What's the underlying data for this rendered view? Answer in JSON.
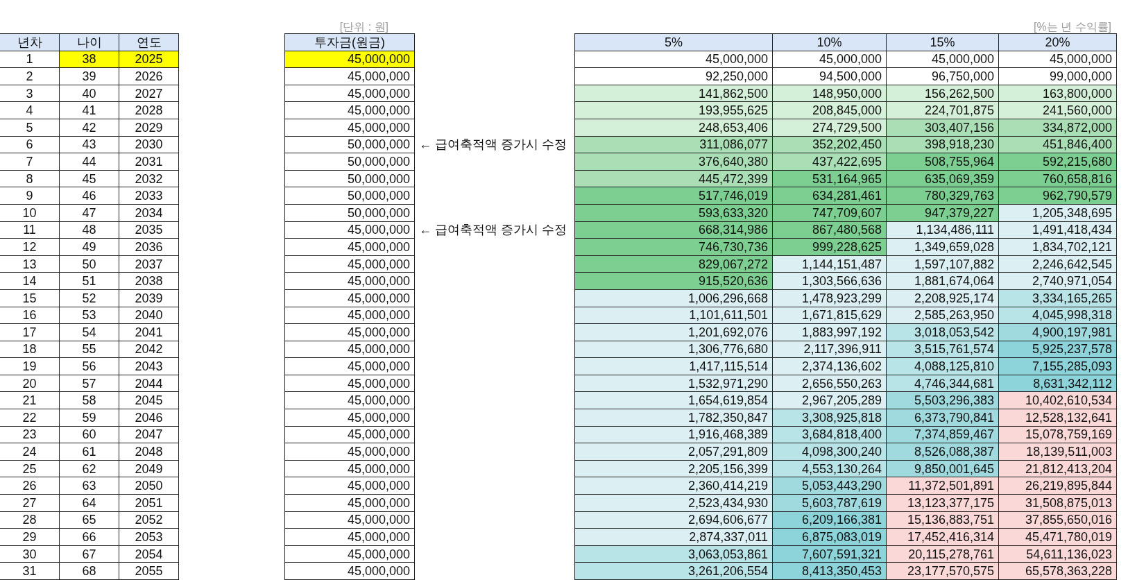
{
  "unit_label": "[단위 : 원]",
  "rate_label": "[%는 년 수익률]",
  "schedule": {
    "columns": [
      "년차",
      "나이",
      "연도"
    ],
    "rows": [
      {
        "year_no": "1",
        "age": "38",
        "year": "2025",
        "highlighted": true
      },
      {
        "year_no": "2",
        "age": "39",
        "year": "2026",
        "highlighted": false
      },
      {
        "year_no": "3",
        "age": "40",
        "year": "2027",
        "highlighted": false
      },
      {
        "year_no": "4",
        "age": "41",
        "year": "2028",
        "highlighted": false
      },
      {
        "year_no": "5",
        "age": "42",
        "year": "2029",
        "highlighted": false
      },
      {
        "year_no": "6",
        "age": "43",
        "year": "2030",
        "highlighted": false
      },
      {
        "year_no": "7",
        "age": "44",
        "year": "2031",
        "highlighted": false
      },
      {
        "year_no": "8",
        "age": "45",
        "year": "2032",
        "highlighted": false
      },
      {
        "year_no": "9",
        "age": "46",
        "year": "2033",
        "highlighted": false
      },
      {
        "year_no": "10",
        "age": "47",
        "year": "2034",
        "highlighted": false
      },
      {
        "year_no": "11",
        "age": "48",
        "year": "2035",
        "highlighted": false
      },
      {
        "year_no": "12",
        "age": "49",
        "year": "2036",
        "highlighted": false
      },
      {
        "year_no": "13",
        "age": "50",
        "year": "2037",
        "highlighted": false
      },
      {
        "year_no": "14",
        "age": "51",
        "year": "2038",
        "highlighted": false
      },
      {
        "year_no": "15",
        "age": "52",
        "year": "2039",
        "highlighted": false
      },
      {
        "year_no": "16",
        "age": "53",
        "year": "2040",
        "highlighted": false
      },
      {
        "year_no": "17",
        "age": "54",
        "year": "2041",
        "highlighted": false
      },
      {
        "year_no": "18",
        "age": "55",
        "year": "2042",
        "highlighted": false
      },
      {
        "year_no": "19",
        "age": "56",
        "year": "2043",
        "highlighted": false
      },
      {
        "year_no": "20",
        "age": "57",
        "year": "2044",
        "highlighted": false
      },
      {
        "year_no": "21",
        "age": "58",
        "year": "2045",
        "highlighted": false
      },
      {
        "year_no": "22",
        "age": "59",
        "year": "2046",
        "highlighted": false
      },
      {
        "year_no": "23",
        "age": "60",
        "year": "2047",
        "highlighted": false
      },
      {
        "year_no": "24",
        "age": "61",
        "year": "2048",
        "highlighted": false
      },
      {
        "year_no": "25",
        "age": "62",
        "year": "2049",
        "highlighted": false
      },
      {
        "year_no": "26",
        "age": "63",
        "year": "2050",
        "highlighted": false
      },
      {
        "year_no": "27",
        "age": "64",
        "year": "2051",
        "highlighted": false
      },
      {
        "year_no": "28",
        "age": "65",
        "year": "2052",
        "highlighted": false
      },
      {
        "year_no": "29",
        "age": "66",
        "year": "2053",
        "highlighted": false
      },
      {
        "year_no": "30",
        "age": "67",
        "year": "2054",
        "highlighted": false
      },
      {
        "year_no": "31",
        "age": "68",
        "year": "2055",
        "highlighted": false
      }
    ]
  },
  "investment": {
    "column": "투자금(원금)",
    "rows": [
      {
        "amount": "45,000,000",
        "highlighted": true
      },
      {
        "amount": "45,000,000",
        "highlighted": false
      },
      {
        "amount": "45,000,000",
        "highlighted": false
      },
      {
        "amount": "45,000,000",
        "highlighted": false
      },
      {
        "amount": "45,000,000",
        "highlighted": false
      },
      {
        "amount": "50,000,000",
        "highlighted": false,
        "note": "← 급여축적액 증가시 수정"
      },
      {
        "amount": "50,000,000",
        "highlighted": false
      },
      {
        "amount": "50,000,000",
        "highlighted": false
      },
      {
        "amount": "50,000,000",
        "highlighted": false
      },
      {
        "amount": "50,000,000",
        "highlighted": false
      },
      {
        "amount": "45,000,000",
        "highlighted": false,
        "note": "← 급여축적액 증가시 수정"
      },
      {
        "amount": "45,000,000",
        "highlighted": false
      },
      {
        "amount": "45,000,000",
        "highlighted": false
      },
      {
        "amount": "45,000,000",
        "highlighted": false
      },
      {
        "amount": "45,000,000",
        "highlighted": false
      },
      {
        "amount": "45,000,000",
        "highlighted": false
      },
      {
        "amount": "45,000,000",
        "highlighted": false
      },
      {
        "amount": "45,000,000",
        "highlighted": false
      },
      {
        "amount": "45,000,000",
        "highlighted": false
      },
      {
        "amount": "45,000,000",
        "highlighted": false
      },
      {
        "amount": "45,000,000",
        "highlighted": false
      },
      {
        "amount": "45,000,000",
        "highlighted": false
      },
      {
        "amount": "45,000,000",
        "highlighted": false
      },
      {
        "amount": "45,000,000",
        "highlighted": false
      },
      {
        "amount": "45,000,000",
        "highlighted": false
      },
      {
        "amount": "45,000,000",
        "highlighted": false
      },
      {
        "amount": "45,000,000",
        "highlighted": false
      },
      {
        "amount": "45,000,000",
        "highlighted": false
      },
      {
        "amount": "45,000,000",
        "highlighted": false
      },
      {
        "amount": "45,000,000",
        "highlighted": false
      },
      {
        "amount": "45,000,000",
        "highlighted": false
      }
    ]
  },
  "returns": {
    "columns": [
      "5%",
      "10%",
      "15%",
      "20%"
    ],
    "rows": [
      {
        "cells": [
          {
            "value": "45,000,000",
            "color": "#ffffff"
          },
          {
            "value": "45,000,000",
            "color": "#ffffff"
          },
          {
            "value": "45,000,000",
            "color": "#ffffff"
          },
          {
            "value": "45,000,000",
            "color": "#ffffff"
          }
        ]
      },
      {
        "cells": [
          {
            "value": "92,250,000",
            "color": "#ffffff"
          },
          {
            "value": "94,500,000",
            "color": "#ffffff"
          },
          {
            "value": "96,750,000",
            "color": "#ffffff"
          },
          {
            "value": "99,000,000",
            "color": "#ffffff"
          }
        ]
      },
      {
        "cells": [
          {
            "value": "141,862,500",
            "color": "#d5f0d8"
          },
          {
            "value": "148,950,000",
            "color": "#d5f0d8"
          },
          {
            "value": "156,262,500",
            "color": "#d5f0d8"
          },
          {
            "value": "163,800,000",
            "color": "#d5f0d8"
          }
        ]
      },
      {
        "cells": [
          {
            "value": "193,955,625",
            "color": "#d5f0d8"
          },
          {
            "value": "208,845,000",
            "color": "#d5f0d8"
          },
          {
            "value": "224,701,875",
            "color": "#d5f0d8"
          },
          {
            "value": "241,560,000",
            "color": "#d5f0d8"
          }
        ]
      },
      {
        "cells": [
          {
            "value": "248,653,406",
            "color": "#d5f0d8"
          },
          {
            "value": "274,729,500",
            "color": "#d5f0d8"
          },
          {
            "value": "303,407,156",
            "color": "#aadfb6"
          },
          {
            "value": "334,872,000",
            "color": "#aadfb6"
          }
        ]
      },
      {
        "cells": [
          {
            "value": "311,086,077",
            "color": "#aadfb6"
          },
          {
            "value": "352,202,450",
            "color": "#aadfb6"
          },
          {
            "value": "398,918,230",
            "color": "#aadfb6"
          },
          {
            "value": "451,846,400",
            "color": "#aadfb6"
          }
        ]
      },
      {
        "cells": [
          {
            "value": "376,640,380",
            "color": "#aadfb6"
          },
          {
            "value": "437,422,695",
            "color": "#aadfb6"
          },
          {
            "value": "508,755,964",
            "color": "#7ccf90"
          },
          {
            "value": "592,215,680",
            "color": "#7ccf90"
          }
        ]
      },
      {
        "cells": [
          {
            "value": "445,472,399",
            "color": "#aadfb6"
          },
          {
            "value": "531,164,965",
            "color": "#7ccf90"
          },
          {
            "value": "635,069,359",
            "color": "#7ccf90"
          },
          {
            "value": "760,658,816",
            "color": "#7ccf90"
          }
        ]
      },
      {
        "cells": [
          {
            "value": "517,746,019",
            "color": "#7ccf90"
          },
          {
            "value": "634,281,461",
            "color": "#7ccf90"
          },
          {
            "value": "780,329,763",
            "color": "#7ccf90"
          },
          {
            "value": "962,790,579",
            "color": "#7ccf90"
          }
        ]
      },
      {
        "cells": [
          {
            "value": "593,633,320",
            "color": "#7ccf90"
          },
          {
            "value": "747,709,607",
            "color": "#7ccf90"
          },
          {
            "value": "947,379,227",
            "color": "#7ccf90"
          },
          {
            "value": "1,205,348,695",
            "color": "#dcf0f4"
          }
        ]
      },
      {
        "cells": [
          {
            "value": "668,314,986",
            "color": "#7ccf90"
          },
          {
            "value": "867,480,568",
            "color": "#7ccf90"
          },
          {
            "value": "1,134,486,111",
            "color": "#dcf0f4"
          },
          {
            "value": "1,491,418,434",
            "color": "#dcf0f4"
          }
        ]
      },
      {
        "cells": [
          {
            "value": "746,730,736",
            "color": "#7ccf90"
          },
          {
            "value": "999,228,625",
            "color": "#7ccf90"
          },
          {
            "value": "1,349,659,028",
            "color": "#dcf0f4"
          },
          {
            "value": "1,834,702,121",
            "color": "#dcf0f4"
          }
        ]
      },
      {
        "cells": [
          {
            "value": "829,067,272",
            "color": "#7ccf90"
          },
          {
            "value": "1,144,151,487",
            "color": "#dcf0f4"
          },
          {
            "value": "1,597,107,882",
            "color": "#dcf0f4"
          },
          {
            "value": "2,246,642,545",
            "color": "#dcf0f4"
          }
        ]
      },
      {
        "cells": [
          {
            "value": "915,520,636",
            "color": "#7ccf90"
          },
          {
            "value": "1,303,566,636",
            "color": "#dcf0f4"
          },
          {
            "value": "1,881,674,064",
            "color": "#dcf0f4"
          },
          {
            "value": "2,740,971,054",
            "color": "#dcf0f4"
          }
        ]
      },
      {
        "cells": [
          {
            "value": "1,006,296,668",
            "color": "#dcf0f4"
          },
          {
            "value": "1,478,923,299",
            "color": "#dcf0f4"
          },
          {
            "value": "2,208,925,174",
            "color": "#dcf0f4"
          },
          {
            "value": "3,334,165,265",
            "color": "#b8e3e7"
          }
        ]
      },
      {
        "cells": [
          {
            "value": "1,101,611,501",
            "color": "#dcf0f4"
          },
          {
            "value": "1,671,815,629",
            "color": "#dcf0f4"
          },
          {
            "value": "2,585,263,950",
            "color": "#dcf0f4"
          },
          {
            "value": "4,045,998,318",
            "color": "#b8e3e7"
          }
        ]
      },
      {
        "cells": [
          {
            "value": "1,201,692,076",
            "color": "#dcf0f4"
          },
          {
            "value": "1,883,997,192",
            "color": "#dcf0f4"
          },
          {
            "value": "3,018,053,542",
            "color": "#b8e3e7"
          },
          {
            "value": "4,900,197,981",
            "color": "#a0dadf"
          }
        ]
      },
      {
        "cells": [
          {
            "value": "1,306,776,680",
            "color": "#dcf0f4"
          },
          {
            "value": "2,117,396,911",
            "color": "#dcf0f4"
          },
          {
            "value": "3,515,761,574",
            "color": "#b8e3e7"
          },
          {
            "value": "5,925,237,578",
            "color": "#8dd3da"
          }
        ]
      },
      {
        "cells": [
          {
            "value": "1,417,115,514",
            "color": "#dcf0f4"
          },
          {
            "value": "2,374,136,602",
            "color": "#dcf0f4"
          },
          {
            "value": "4,088,125,810",
            "color": "#b8e3e7"
          },
          {
            "value": "7,155,285,093",
            "color": "#8dd3da"
          }
        ]
      },
      {
        "cells": [
          {
            "value": "1,532,971,290",
            "color": "#dcf0f4"
          },
          {
            "value": "2,656,550,263",
            "color": "#dcf0f4"
          },
          {
            "value": "4,746,344,681",
            "color": "#b8e3e7"
          },
          {
            "value": "8,631,342,112",
            "color": "#8dd3da"
          }
        ]
      },
      {
        "cells": [
          {
            "value": "1,654,619,854",
            "color": "#dcf0f4"
          },
          {
            "value": "2,967,205,289",
            "color": "#dcf0f4"
          },
          {
            "value": "5,503,296,383",
            "color": "#a0dadf"
          },
          {
            "value": "10,402,610,534",
            "color": "#fbd8d8"
          }
        ]
      },
      {
        "cells": [
          {
            "value": "1,782,350,847",
            "color": "#dcf0f4"
          },
          {
            "value": "3,308,925,818",
            "color": "#b8e3e7"
          },
          {
            "value": "6,373,790,841",
            "color": "#a0dadf"
          },
          {
            "value": "12,528,132,641",
            "color": "#fbd8d8"
          }
        ]
      },
      {
        "cells": [
          {
            "value": "1,916,468,389",
            "color": "#dcf0f4"
          },
          {
            "value": "3,684,818,400",
            "color": "#b8e3e7"
          },
          {
            "value": "7,374,859,467",
            "color": "#a0dadf"
          },
          {
            "value": "15,078,759,169",
            "color": "#fbd8d8"
          }
        ]
      },
      {
        "cells": [
          {
            "value": "2,057,291,809",
            "color": "#dcf0f4"
          },
          {
            "value": "4,098,300,240",
            "color": "#b8e3e7"
          },
          {
            "value": "8,526,088,387",
            "color": "#a0dadf"
          },
          {
            "value": "18,139,511,003",
            "color": "#fbd8d8"
          }
        ]
      },
      {
        "cells": [
          {
            "value": "2,205,156,399",
            "color": "#dcf0f4"
          },
          {
            "value": "4,553,130,264",
            "color": "#b8e3e7"
          },
          {
            "value": "9,850,001,645",
            "color": "#a0dadf"
          },
          {
            "value": "21,812,413,204",
            "color": "#fbd8d8"
          }
        ]
      },
      {
        "cells": [
          {
            "value": "2,360,414,219",
            "color": "#dcf0f4"
          },
          {
            "value": "5,053,443,290",
            "color": "#a0dadf"
          },
          {
            "value": "11,372,501,891",
            "color": "#fbd8d8"
          },
          {
            "value": "26,219,895,844",
            "color": "#fbd8d8"
          }
        ]
      },
      {
        "cells": [
          {
            "value": "2,523,434,930",
            "color": "#dcf0f4"
          },
          {
            "value": "5,603,787,619",
            "color": "#a0dadf"
          },
          {
            "value": "13,123,377,175",
            "color": "#fbd8d8"
          },
          {
            "value": "31,508,875,013",
            "color": "#fbd8d8"
          }
        ]
      },
      {
        "cells": [
          {
            "value": "2,694,606,677",
            "color": "#dcf0f4"
          },
          {
            "value": "6,209,166,381",
            "color": "#8dd3da"
          },
          {
            "value": "15,136,883,751",
            "color": "#fbd8d8"
          },
          {
            "value": "37,855,650,016",
            "color": "#fbd8d8"
          }
        ]
      },
      {
        "cells": [
          {
            "value": "2,874,337,011",
            "color": "#dcf0f4"
          },
          {
            "value": "6,875,083,019",
            "color": "#8dd3da"
          },
          {
            "value": "17,452,416,314",
            "color": "#fbd8d8"
          },
          {
            "value": "45,471,780,019",
            "color": "#fbd8d8"
          }
        ]
      },
      {
        "cells": [
          {
            "value": "3,063,053,861",
            "color": "#b8e3e7"
          },
          {
            "value": "7,607,591,321",
            "color": "#8dd3da"
          },
          {
            "value": "20,115,278,761",
            "color": "#fbd8d8"
          },
          {
            "value": "54,611,136,023",
            "color": "#fbd8d8"
          }
        ]
      },
      {
        "cells": [
          {
            "value": "3,261,206,554",
            "color": "#b8e3e7"
          },
          {
            "value": "8,413,350,453",
            "color": "#8dd3da"
          },
          {
            "value": "23,177,570,575",
            "color": "#fbd8d8"
          },
          {
            "value": "65,578,363,228",
            "color": "#fbd8d8"
          }
        ]
      }
    ]
  }
}
